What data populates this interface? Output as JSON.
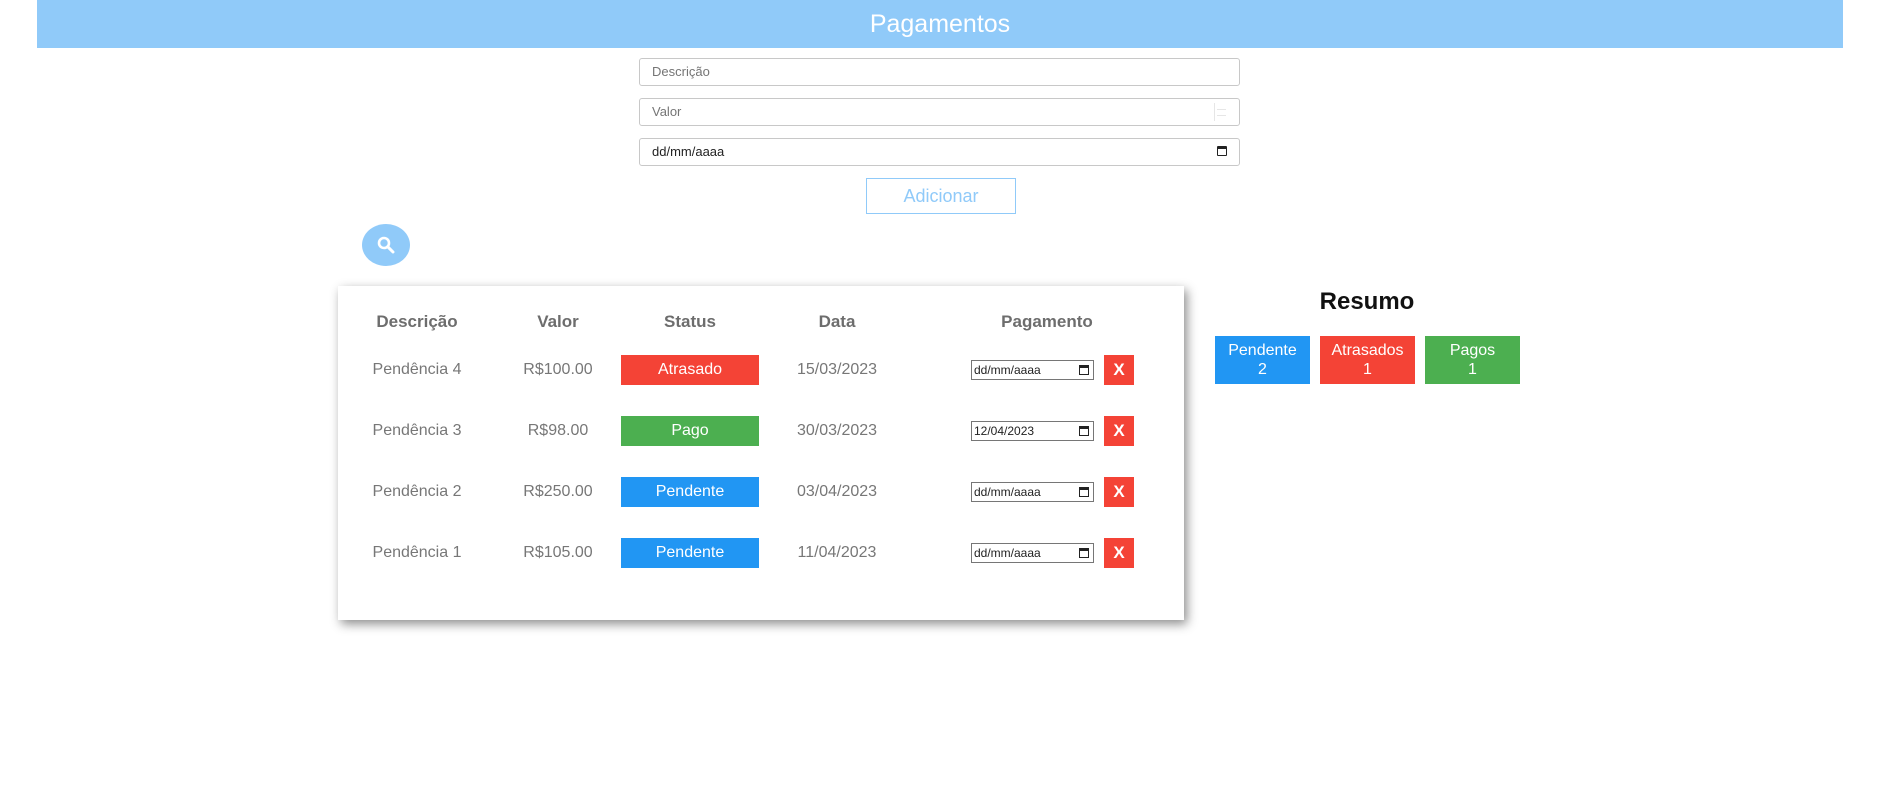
{
  "header": {
    "title": "Pagamentos"
  },
  "form": {
    "descricao_placeholder": "Descrição",
    "valor_placeholder": "Valor",
    "data_placeholder": "dd/mm/aaaa",
    "add_label": "Adicionar"
  },
  "table": {
    "headers": [
      "Descrição",
      "Valor",
      "Status",
      "Data",
      "Pagamento"
    ],
    "rows": [
      {
        "descricao": "Pendência 4",
        "valor": "R$100.00",
        "status": "Atrasado",
        "data": "15/03/2023",
        "pagamento": "dd/mm/aaaa",
        "delete_label": "X"
      },
      {
        "descricao": "Pendência 3",
        "valor": "R$98.00",
        "status": "Pago",
        "data": "30/03/2023",
        "pagamento": "12/04/2023",
        "delete_label": "X"
      },
      {
        "descricao": "Pendência 2",
        "valor": "R$250.00",
        "status": "Pendente",
        "data": "03/04/2023",
        "pagamento": "dd/mm/aaaa",
        "delete_label": "X"
      },
      {
        "descricao": "Pendência 1",
        "valor": "R$105.00",
        "status": "Pendente",
        "data": "11/04/2023",
        "pagamento": "dd/mm/aaaa",
        "delete_label": "X"
      }
    ]
  },
  "resumo": {
    "title": "Resumo",
    "boxes": [
      {
        "label": "Pendente",
        "count": "2"
      },
      {
        "label": "Atrasados",
        "count": "1"
      },
      {
        "label": "Pagos",
        "count": "1"
      }
    ]
  },
  "colors": {
    "header": "#90caf9",
    "atrasado": "#f44336",
    "pago": "#4caf50",
    "pendente": "#2196f3"
  },
  "icons": {
    "search": "search-icon",
    "calendar": "calendar-icon"
  }
}
